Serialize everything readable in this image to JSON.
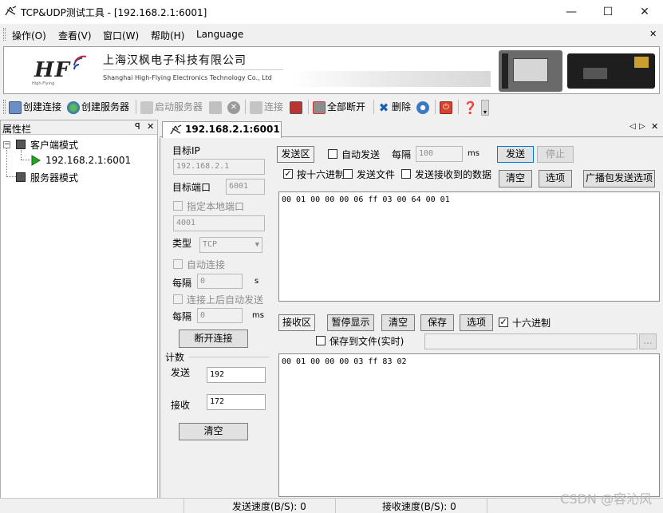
{
  "window": {
    "title": "TCP&UDP测试工具 - [192.168.2.1:6001]",
    "icon": "tcp-udp-tool-icon",
    "minimize": "—",
    "maximize": "☐",
    "close": "✕"
  },
  "menu": {
    "items": [
      "操作(O)",
      "查看(V)",
      "窗口(W)",
      "帮助(H)",
      "Language"
    ],
    "close_glyph": "✕"
  },
  "banner": {
    "logo_text": "HF",
    "logo_sub": "High-Flying",
    "company_cn": "上海汉枫电子科技有限公司",
    "company_en": "Shanghai High-Flying Electronics Technology Co., Ltd"
  },
  "toolbar": {
    "create_connection": "创建连接",
    "create_server": "创建服务器",
    "start_server": "启动服务器",
    "connect": "连接",
    "disconnect_all": "全部断开",
    "delete": "删除"
  },
  "left_panel": {
    "title": "属性栏",
    "pin": "ᵖ",
    "close": "✕",
    "tree": {
      "client_mode": "客户端模式",
      "client_connection": "192.168.2.1:6001",
      "server_mode": "服务器模式"
    }
  },
  "tab": {
    "label": "192.168.2.1:6001",
    "nav_prev": "◁",
    "nav_next": "▷",
    "close": "✕"
  },
  "settings": {
    "target_ip_label": "目标IP",
    "target_ip": "192.168.2.1",
    "target_port_label": "目标端口",
    "target_port": "6001",
    "local_port_label": "指定本地端口",
    "local_port": "4001",
    "type_label": "类型",
    "type_value": "TCP",
    "auto_connect_label": "自动连接",
    "interval_label": "每隔",
    "auto_connect_interval": "0",
    "auto_connect_unit": "s",
    "auto_send_after_label": "连接上后自动发送",
    "auto_send_after_interval": "0",
    "auto_send_after_unit": "ms",
    "disconnect_button": "断开连接",
    "count_label": "计数",
    "send_count_label": "发送",
    "send_count": "192",
    "recv_count_label": "接收",
    "recv_count": "172",
    "clear_button": "清空"
  },
  "send_area": {
    "title": "发送区",
    "auto_send_label": "自动发送",
    "auto_send_checked": false,
    "interval_label": "每隔",
    "interval_value": "100",
    "interval_unit": "ms",
    "send_button": "发送",
    "stop_button": "停止",
    "hex_label": "按十六进制",
    "hex_checked": true,
    "send_file_label": "发送文件",
    "send_file_checked": false,
    "send_received_label": "发送接收到的数据",
    "send_received_checked": false,
    "clear_button": "清空",
    "options_button": "选项",
    "broadcast_button": "广播包发送选项",
    "content": "00 01 00 00 00 06 ff 03 00 64 00 01"
  },
  "recv_area": {
    "title": "接收区",
    "pause_button": "暂停显示",
    "clear_button": "清空",
    "save_button": "保存",
    "options_button": "选项",
    "hex_label": "十六进制",
    "hex_checked": true,
    "save_file_label": "保存到文件(实时)",
    "save_file_checked": false,
    "browse_button": "...",
    "content": "00 01 00 00 00 03 ff 83 02"
  },
  "status": {
    "send_speed": "发送速度(B/S): 0",
    "recv_speed": "接收速度(B/S): 0"
  },
  "watermark": "CSDN @容沁风",
  "colors": {
    "accent_blue": "#0078d7",
    "play_green": "#22a622"
  }
}
